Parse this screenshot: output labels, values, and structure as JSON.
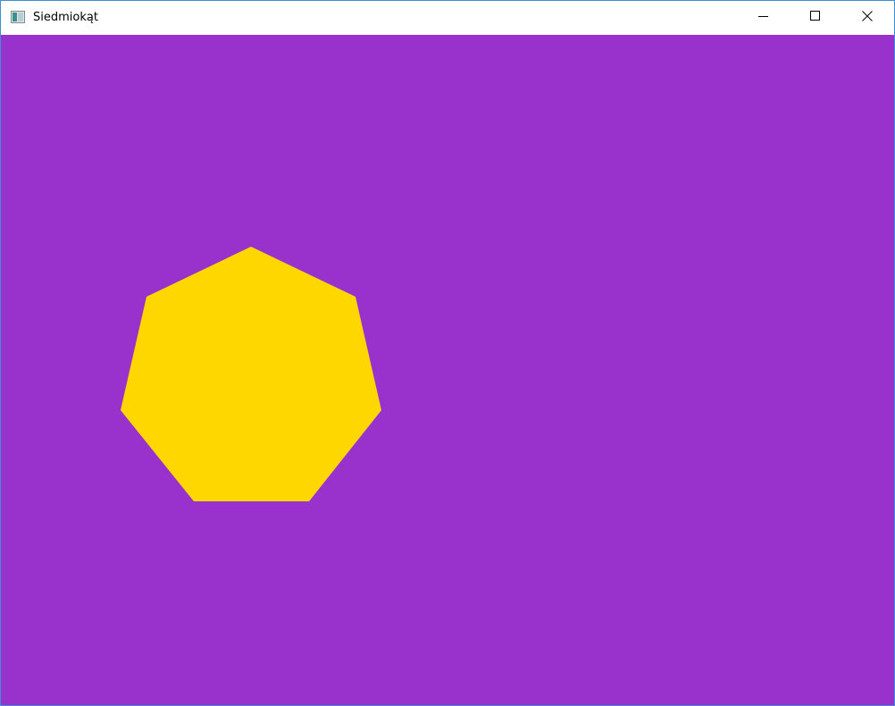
{
  "window": {
    "title": "Siedmiokąt",
    "icon": "app-window-icon",
    "controls": {
      "minimize_icon": "minimize-icon",
      "maximize_icon": "maximize-icon",
      "close_icon": "close-icon"
    }
  },
  "canvas": {
    "background_color": "#9932CC",
    "shape": {
      "type": "heptagon",
      "fill_color": "#FFD700"
    }
  }
}
